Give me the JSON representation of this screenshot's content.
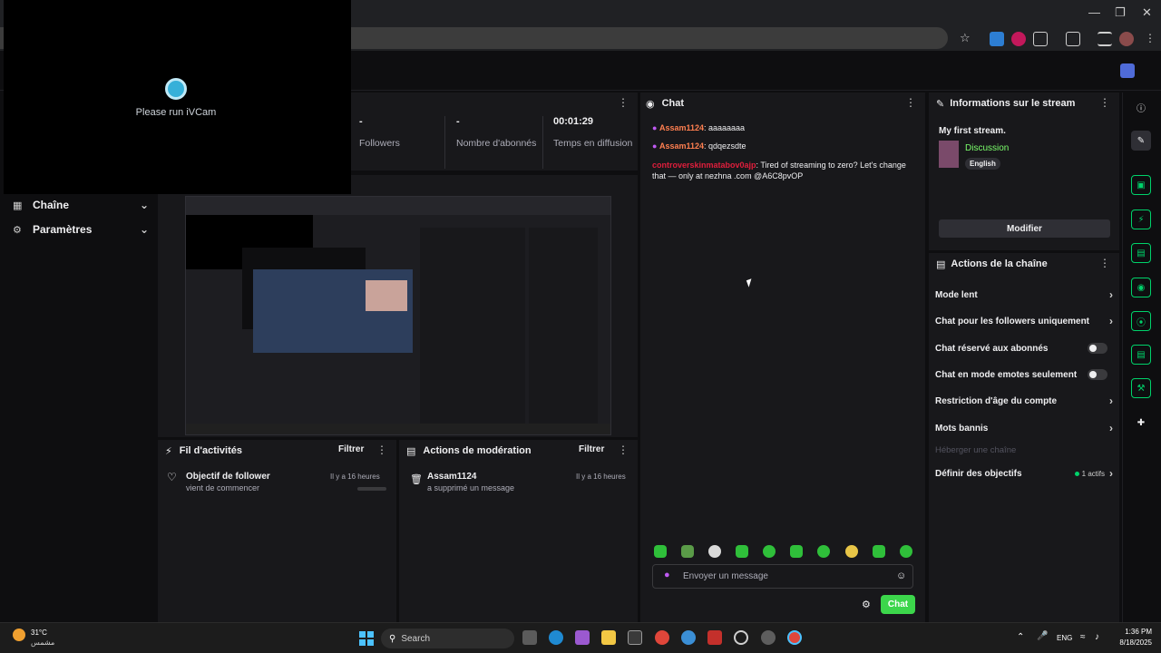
{
  "ivcam": {
    "message": "Please run iVCam"
  },
  "sidebar": {
    "items": [
      {
        "label": "Chaîne",
        "icon": "grid-icon"
      },
      {
        "label": "Paramètres",
        "icon": "gear-icon"
      }
    ]
  },
  "stats": [
    {
      "value": "-",
      "label": "Followers"
    },
    {
      "value": "-",
      "label": "Nombre d'abonnés"
    },
    {
      "value": "00:01:29",
      "label": "Temps en diffusion"
    }
  ],
  "activity": {
    "title": "Fil d'activités",
    "filter": "Filtrer",
    "item": {
      "title": "Objectif de follower",
      "sub": "vient de commencer",
      "time": "Il y a 16 heures"
    }
  },
  "moderation": {
    "title": "Actions de modération",
    "filter": "Filtrer",
    "item": {
      "title": "Assam1124",
      "sub": "a supprimé un message",
      "time": "Il y a 16 heures"
    }
  },
  "chat": {
    "title": "Chat",
    "messages": [
      {
        "user": "Assam1124",
        "text": ": aaaaaaaa",
        "color": "#ff7f50"
      },
      {
        "user": "Assam1124",
        "text": ": qdqezsdte",
        "color": "#ff7f50"
      },
      {
        "user": "controverskinmatabov0ajp",
        "text": ": Tired of streaming to zero? Let's change that — only at nezhna .com @A6C8pvOP",
        "color": "#e01e3c"
      }
    ],
    "placeholder": "Envoyer un message",
    "send": "Chat"
  },
  "stream_info": {
    "title": "Informations sur le stream",
    "stream_title": "My first stream.",
    "category": "Discussion",
    "tag": "English",
    "edit": "Modifier"
  },
  "channel_actions": {
    "title": "Actions de la chaîne",
    "items": [
      {
        "label": "Mode lent",
        "control": "chevron"
      },
      {
        "label": "Chat pour les followers uniquement",
        "control": "chevron"
      },
      {
        "label": "Chat réservé aux abonnés",
        "control": "toggle"
      },
      {
        "label": "Chat en mode emotes seulement",
        "control": "toggle"
      },
      {
        "label": "Restriction d'âge du compte",
        "control": "chevron"
      },
      {
        "label": "Mots bannis",
        "control": "chevron"
      },
      {
        "label": "Héberger une chaîne",
        "control": "none"
      },
      {
        "label": "Définir des objectifs",
        "control": "chevron",
        "badge": "1 actifs"
      }
    ]
  },
  "taskbar": {
    "weather_temp": "31°C",
    "weather_desc": "مشمس",
    "search": "Search",
    "lang": "ENG",
    "time": "1:36 PM",
    "date": "8/18/2025"
  },
  "colors": {
    "accent": "#00f593",
    "twitch_purple": "#9147ff",
    "chat_button": "#3cd64b"
  }
}
